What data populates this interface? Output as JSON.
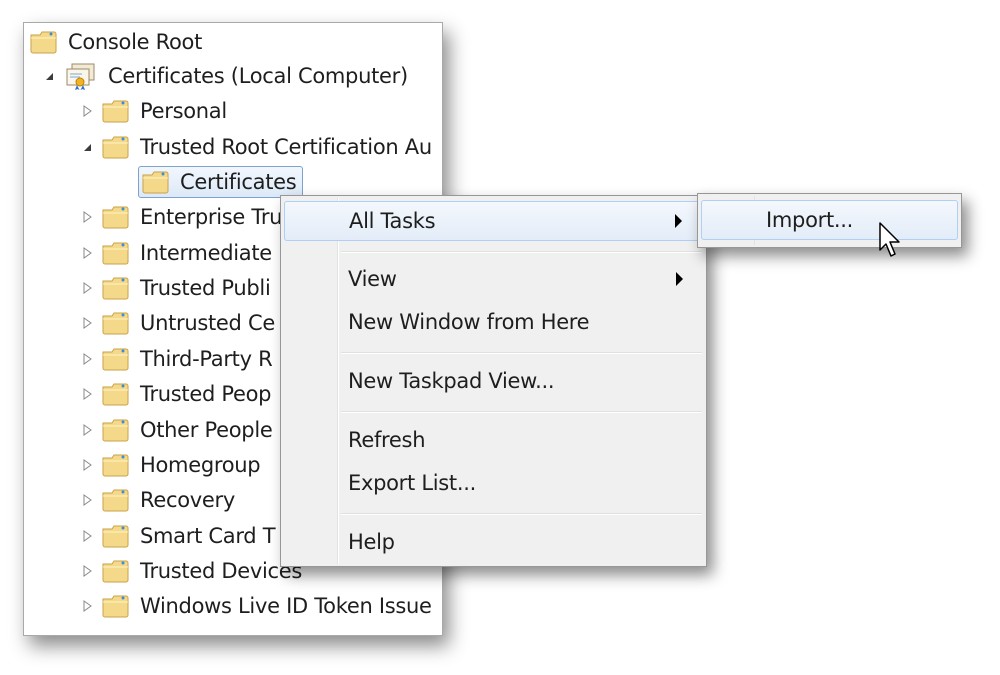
{
  "tree": {
    "items": [
      {
        "label": "Console Root",
        "level": 0,
        "expander": "none",
        "icon": "folder-icon"
      },
      {
        "label": "Certificates (Local Computer)",
        "level": 1,
        "expander": "expanded",
        "icon": "certificate-store-icon"
      },
      {
        "label": "Personal",
        "level": 2,
        "expander": "collapsed",
        "icon": "folder-icon"
      },
      {
        "label": "Trusted Root Certification Au",
        "level": 2,
        "expander": "expanded",
        "icon": "folder-icon"
      },
      {
        "label": "Certificates",
        "level": 3,
        "expander": "none",
        "icon": "folder-icon",
        "selected": true
      },
      {
        "label": "Enterprise Tru",
        "level": 2,
        "expander": "collapsed",
        "icon": "folder-icon"
      },
      {
        "label": "Intermediate",
        "level": 2,
        "expander": "collapsed",
        "icon": "folder-icon"
      },
      {
        "label": "Trusted Publi",
        "level": 2,
        "expander": "collapsed",
        "icon": "folder-icon"
      },
      {
        "label": "Untrusted Ce",
        "level": 2,
        "expander": "collapsed",
        "icon": "folder-icon"
      },
      {
        "label": "Third-Party R",
        "level": 2,
        "expander": "collapsed",
        "icon": "folder-icon"
      },
      {
        "label": "Trusted Peop",
        "level": 2,
        "expander": "collapsed",
        "icon": "folder-icon"
      },
      {
        "label": "Other People",
        "level": 2,
        "expander": "collapsed",
        "icon": "folder-icon"
      },
      {
        "label": "Homegroup",
        "level": 2,
        "expander": "collapsed",
        "icon": "folder-icon"
      },
      {
        "label": "Recovery",
        "level": 2,
        "expander": "collapsed",
        "icon": "folder-icon"
      },
      {
        "label": "Smart Card T",
        "level": 2,
        "expander": "collapsed",
        "icon": "folder-icon"
      },
      {
        "label": "Trusted Devices",
        "level": 2,
        "expander": "collapsed",
        "icon": "folder-icon"
      },
      {
        "label": "Windows Live ID Token Issue",
        "level": 2,
        "expander": "collapsed",
        "icon": "folder-icon"
      }
    ]
  },
  "context_menu": {
    "items": [
      {
        "label": "All Tasks",
        "submenu": true,
        "highlighted": true
      },
      {
        "label": "View",
        "submenu": true
      },
      {
        "label": "New Window from Here"
      },
      {
        "label": "New Taskpad View..."
      },
      {
        "label": "Refresh"
      },
      {
        "label": "Export List..."
      },
      {
        "label": "Help"
      }
    ]
  },
  "submenu": {
    "items": [
      {
        "label": "Import...",
        "highlighted": true
      }
    ]
  },
  "colors": {
    "menu_background": "#f0f0f0",
    "highlight_border": "#aecff7",
    "selection_border": "#7da2ce",
    "folder_fill": "#f5d98a"
  }
}
